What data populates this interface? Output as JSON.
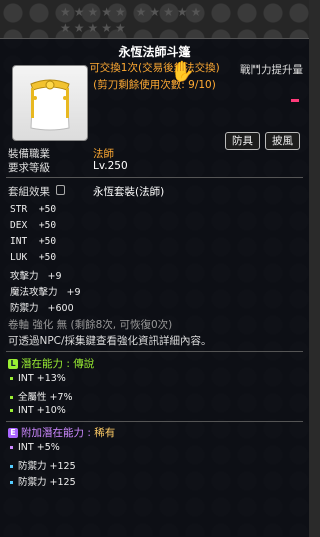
{
  "item": {
    "name": "永恆法師斗篷",
    "trade_note": "可交換1次(交易後無法交換)",
    "scissor_note": "(剪刀剩餘使用次數: 9/10)"
  },
  "power_label": "戰鬥力提升量",
  "tags": [
    "防具",
    "披風"
  ],
  "requirements": {
    "job_label": "裝備職業",
    "job_value": "法師",
    "level_label": "要求等級",
    "level_value": "Lv.250"
  },
  "set": {
    "label": "套組效果",
    "value": "永恆套裝(法師)"
  },
  "stats": [
    {
      "name": "STR",
      "value": "+50"
    },
    {
      "name": "DEX",
      "value": "+50"
    },
    {
      "name": "INT",
      "value": "+50"
    },
    {
      "name": "LUK",
      "value": "+50"
    },
    {
      "name": "攻擊力",
      "value": "+9"
    },
    {
      "name": "魔法攻擊力",
      "value": "+9"
    },
    {
      "name": "防禦力",
      "value": "+600"
    }
  ],
  "scroll_line": "卷軸 強化 無 (剩餘8次, 可恢復0次)",
  "npc_note": "可透過NPC/採集鍵查看強化資訊詳細內容。",
  "potential": {
    "badge": "L",
    "label": "潛在能力 : ",
    "grade": "傳說",
    "lines": [
      "INT +13%",
      "全屬性 +7%",
      "INT +10%"
    ],
    "color": "#99ee33"
  },
  "additional": {
    "badge": "E",
    "label": "附加潛在能力 : ",
    "grade": "稀有",
    "lines": [
      "INT +5%",
      "防禦力 +125",
      "防禦力 +125"
    ],
    "colors": [
      "#cc88ff",
      "#55ccff",
      "#55ccff"
    ]
  },
  "bg_stars": "★★★★★ ★★★★★ ★★★★★"
}
